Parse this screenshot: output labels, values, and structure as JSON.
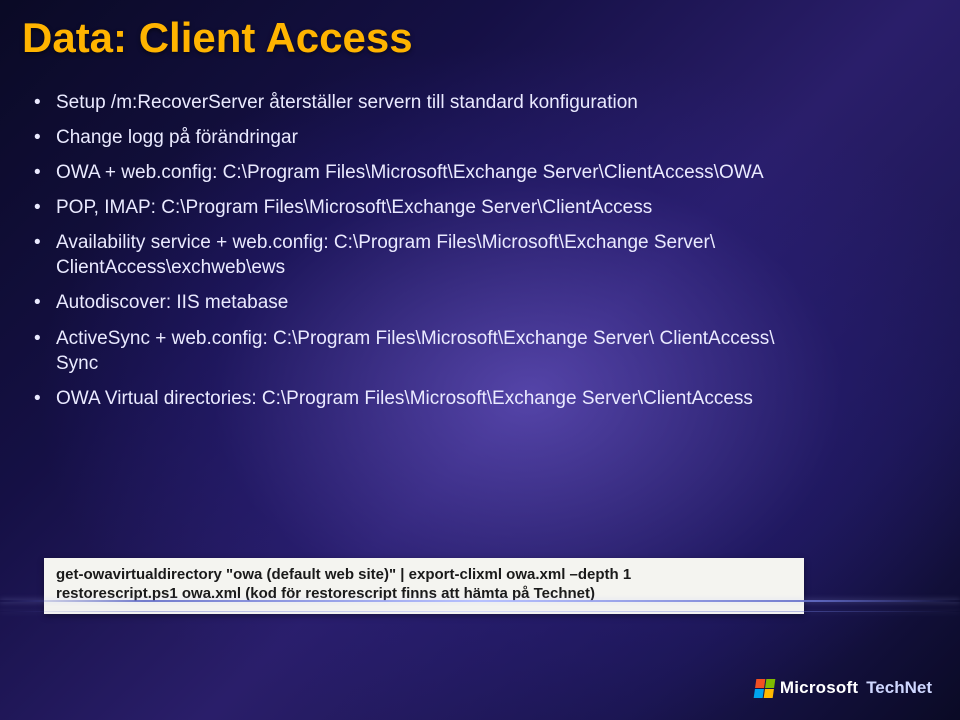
{
  "title": "Data: Client Access",
  "bullets": {
    "b0": "Setup /m:RecoverServer återställer servern till standard konfiguration",
    "b1": "Change logg på förändringar",
    "b2": "OWA + web.config: C:\\Program Files\\Microsoft\\Exchange Server\\ClientAccess\\OWA",
    "b3": "POP, IMAP: C:\\Program Files\\Microsoft\\Exchange Server\\ClientAccess",
    "b4a": "Availability service + web.config: C:\\Program Files\\Microsoft\\Exchange Server\\",
    "b4b": "ClientAccess\\exchweb\\ews",
    "b5": "Autodiscover: IIS metabase",
    "b6a": "ActiveSync + web.config: C:\\Program Files\\Microsoft\\Exchange Server\\ ClientAccess\\",
    "b6b": "Sync",
    "b7": "OWA Virtual directories: C:\\Program Files\\Microsoft\\Exchange Server\\ClientAccess"
  },
  "codebox": {
    "line1": "get-owavirtualdirectory \"owa (default web site)\" | export-clixml owa.xml –depth 1",
    "line2": "restorescript.ps1 owa.xml (kod för restorescript finns att hämta på Technet)"
  },
  "footer": {
    "brand1a": "Microsoft",
    "brand2": "TechNet"
  }
}
